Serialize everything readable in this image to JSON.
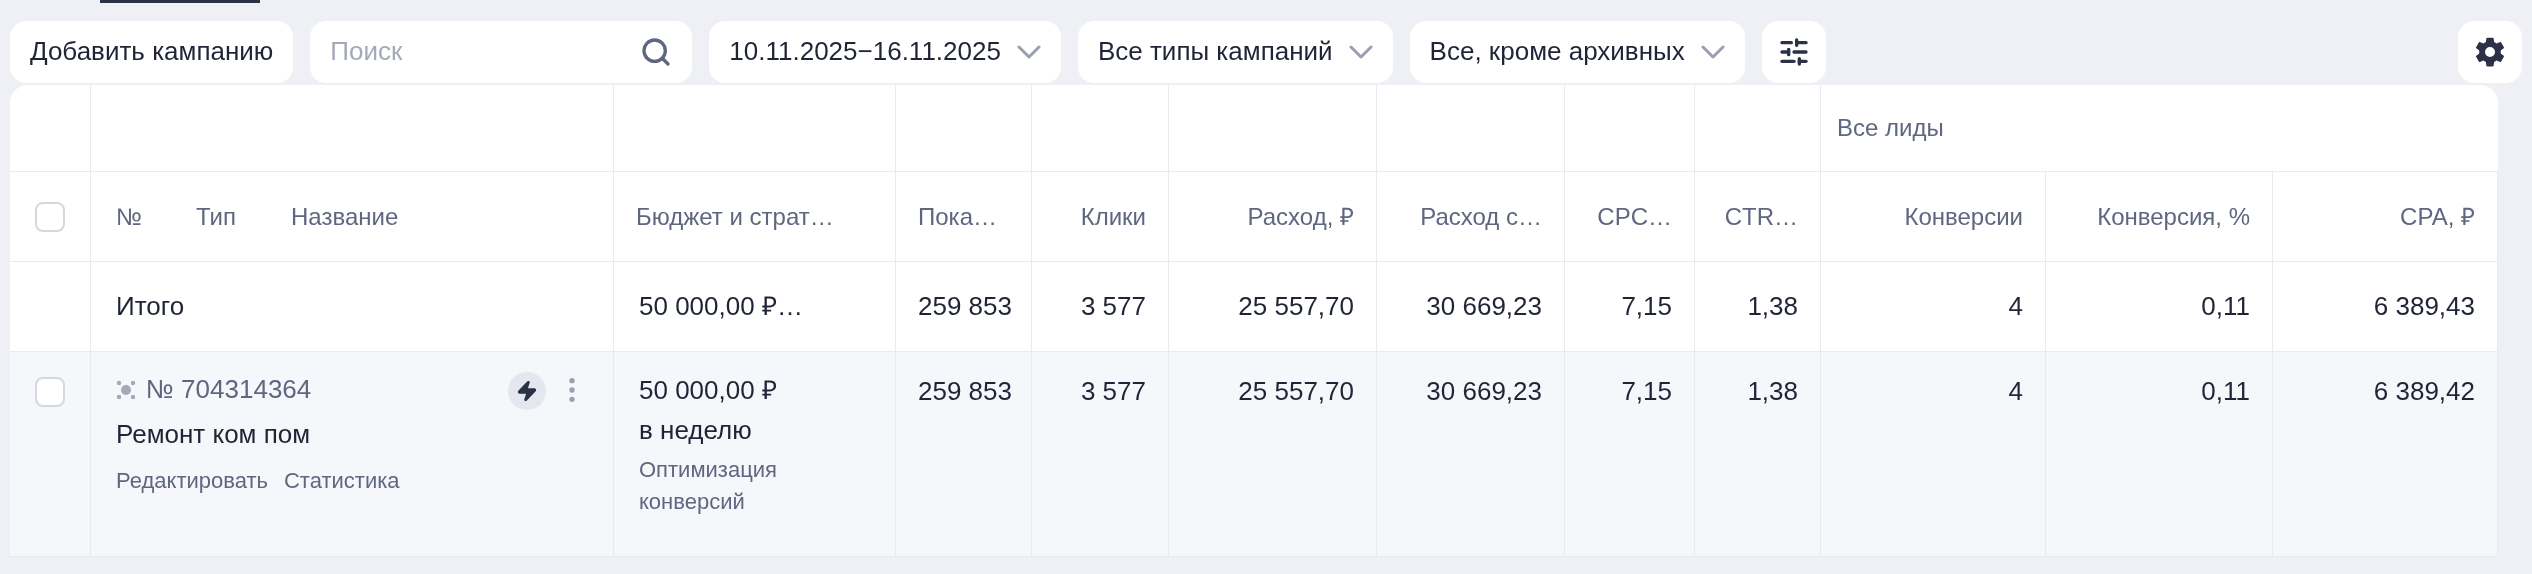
{
  "toolbar": {
    "add_button": "Добавить кампанию",
    "search": {
      "placeholder": "Поиск"
    },
    "filters": [
      {
        "label": "10.11.2025−16.11.2025"
      },
      {
        "label": "Все типы кампаний"
      },
      {
        "label": "Все, кроме архивных"
      }
    ]
  },
  "table": {
    "header_checkbox": {
      "checked": false
    },
    "column_group": "Все лиды",
    "name_headers": [
      "№",
      "Тип",
      "Название"
    ],
    "budget_header": "Бюджет и страт…",
    "columns": [
      "Пока…",
      "Клики",
      "Расход, ₽",
      "Расход с…",
      "CPC…",
      "CTR…",
      "Конверсии",
      "Конверсия, %",
      "CPA, ₽"
    ],
    "rows": [
      {
        "kind": "total",
        "label": "Итого",
        "budget": "50 000,00 ₽…",
        "cells": [
          "259 853",
          "3 577",
          "25 557,70",
          "30 669,23",
          "7,15",
          "1,38",
          "4",
          "0,11",
          "6 389,43"
        ]
      },
      {
        "kind": "campaign",
        "checked": false,
        "number": "№ 704314364",
        "name": "Ремонт ком пом",
        "links": [
          "Редактировать",
          "Статистика"
        ],
        "budget": "50 000,00 ₽",
        "budget_period": "в неделю",
        "strategy": "Оптимизация конверсий",
        "cells": [
          "259 853",
          "3 577",
          "25 557,70",
          "30 669,23",
          "7,15",
          "1,38",
          "4",
          "0,11",
          "6 389,42"
        ]
      }
    ]
  }
}
